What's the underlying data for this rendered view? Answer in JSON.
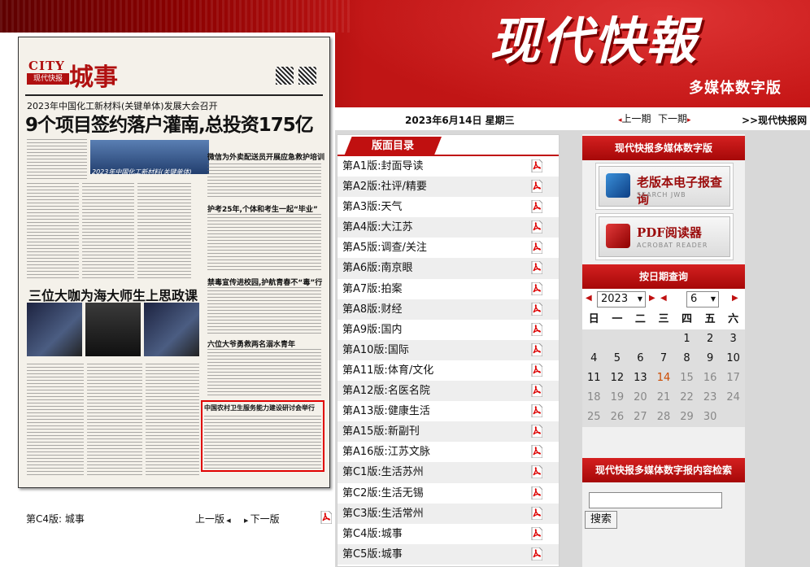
{
  "header": {
    "brand_title": "现代快報",
    "brand_subtitle": "多媒体数字版",
    "date": "2023年6月14日 星期三",
    "prev_issue": "上一期",
    "next_issue": "下一期",
    "site_link": ">>现代快报网"
  },
  "paper": {
    "city_word": "CITY",
    "city_badge": "现代快报",
    "city_name": "城事",
    "sub_headline": "2023年中国化工新材料(关键单体)发展大会召开",
    "headline": "9个项目签约落户灌南,总投资175亿",
    "ribbon_text": "2023年中国化工新材料(关键单体)",
    "headline2": "三位大咖为海大师生上思政课",
    "side_heads": [
      "微信为外卖配送员开展应急救护培训",
      "护考25年,个体和考生一起“毕业”",
      "禁毒宣传进校园,护航青春不“毒”行",
      "六位大爷勇救两名溺水青年"
    ],
    "redbox_title": "中国农村卫生服务能力建设研讨会举行",
    "section_label": "第C4版:  城事",
    "prev_page": "上一版",
    "next_page": "下一版"
  },
  "section_list": {
    "title": "版面目录",
    "items": [
      "第A1版:封面导读",
      "第A2版:社评/精要",
      "第A3版:天气",
      "第A4版:大江苏",
      "第A5版:调查/关注",
      "第A6版:南京眼",
      "第A7版:拍案",
      "第A8版:财经",
      "第A9版:国内",
      "第A10版:国际",
      "第A11版:体育/文化",
      "第A12版:名医名院",
      "第A13版:健康生活",
      "第A15版:新副刊",
      "第A16版:江苏文脉",
      "第C1版:生活苏州",
      "第C2版:生活无锡",
      "第C3版:生活常州",
      "第C4版:城事",
      "第C5版:城事"
    ]
  },
  "right": {
    "digital_title": "现代快报多媒体数字版",
    "promo1_title": "老版本电子报查询",
    "promo1_sub": "SEARCH JWB",
    "promo2_title": "PDF阅读器",
    "promo2_sub": "ACROBAT READER",
    "date_query_title": "按日期查询",
    "year": "2023",
    "month": "6",
    "weekdays": [
      "日",
      "一",
      "二",
      "三",
      "四",
      "五",
      "六"
    ],
    "weeks": [
      [
        "",
        "",
        "",
        "",
        "1",
        "2",
        "3"
      ],
      [
        "4",
        "5",
        "6",
        "7",
        "8",
        "9",
        "10"
      ],
      [
        "11",
        "12",
        "13",
        "14",
        "15",
        "16",
        "17"
      ],
      [
        "18",
        "19",
        "20",
        "21",
        "22",
        "23",
        "24"
      ],
      [
        "25",
        "26",
        "27",
        "28",
        "29",
        "30",
        ""
      ]
    ],
    "today": "14",
    "search_title": "现代快报多媒体数字报内容检索",
    "search_button": "搜索",
    "search_value": ""
  },
  "colors": {
    "accent": "#c01010",
    "today": "#cc4b00"
  }
}
